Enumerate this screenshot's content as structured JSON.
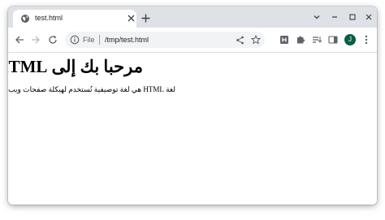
{
  "tab": {
    "title": "test.html",
    "favicon": "globe-icon"
  },
  "window_controls": [
    "chevron-down-icon",
    "minimize-icon",
    "maximize-icon",
    "close-icon"
  ],
  "toolbar": {
    "back": "back-arrow-icon",
    "forward": "forward-arrow-icon",
    "reload": "reload-icon"
  },
  "omnibox": {
    "scheme_label": "File",
    "url": "/tmp/test.html"
  },
  "extensions": [
    "share-icon",
    "bookmark-star-icon",
    "h-extension-icon",
    "puzzle-extensions-icon",
    "reading-list-icon",
    "side-panel-icon"
  ],
  "profile": {
    "initial": "J",
    "color": "#0b5c46"
  },
  "page": {
    "heading": "مرحبا بك إلى HTML",
    "paragraph": "لغة HTML هي لغة توصيفية تُستخدم لهيكلة صفحات ويب"
  }
}
